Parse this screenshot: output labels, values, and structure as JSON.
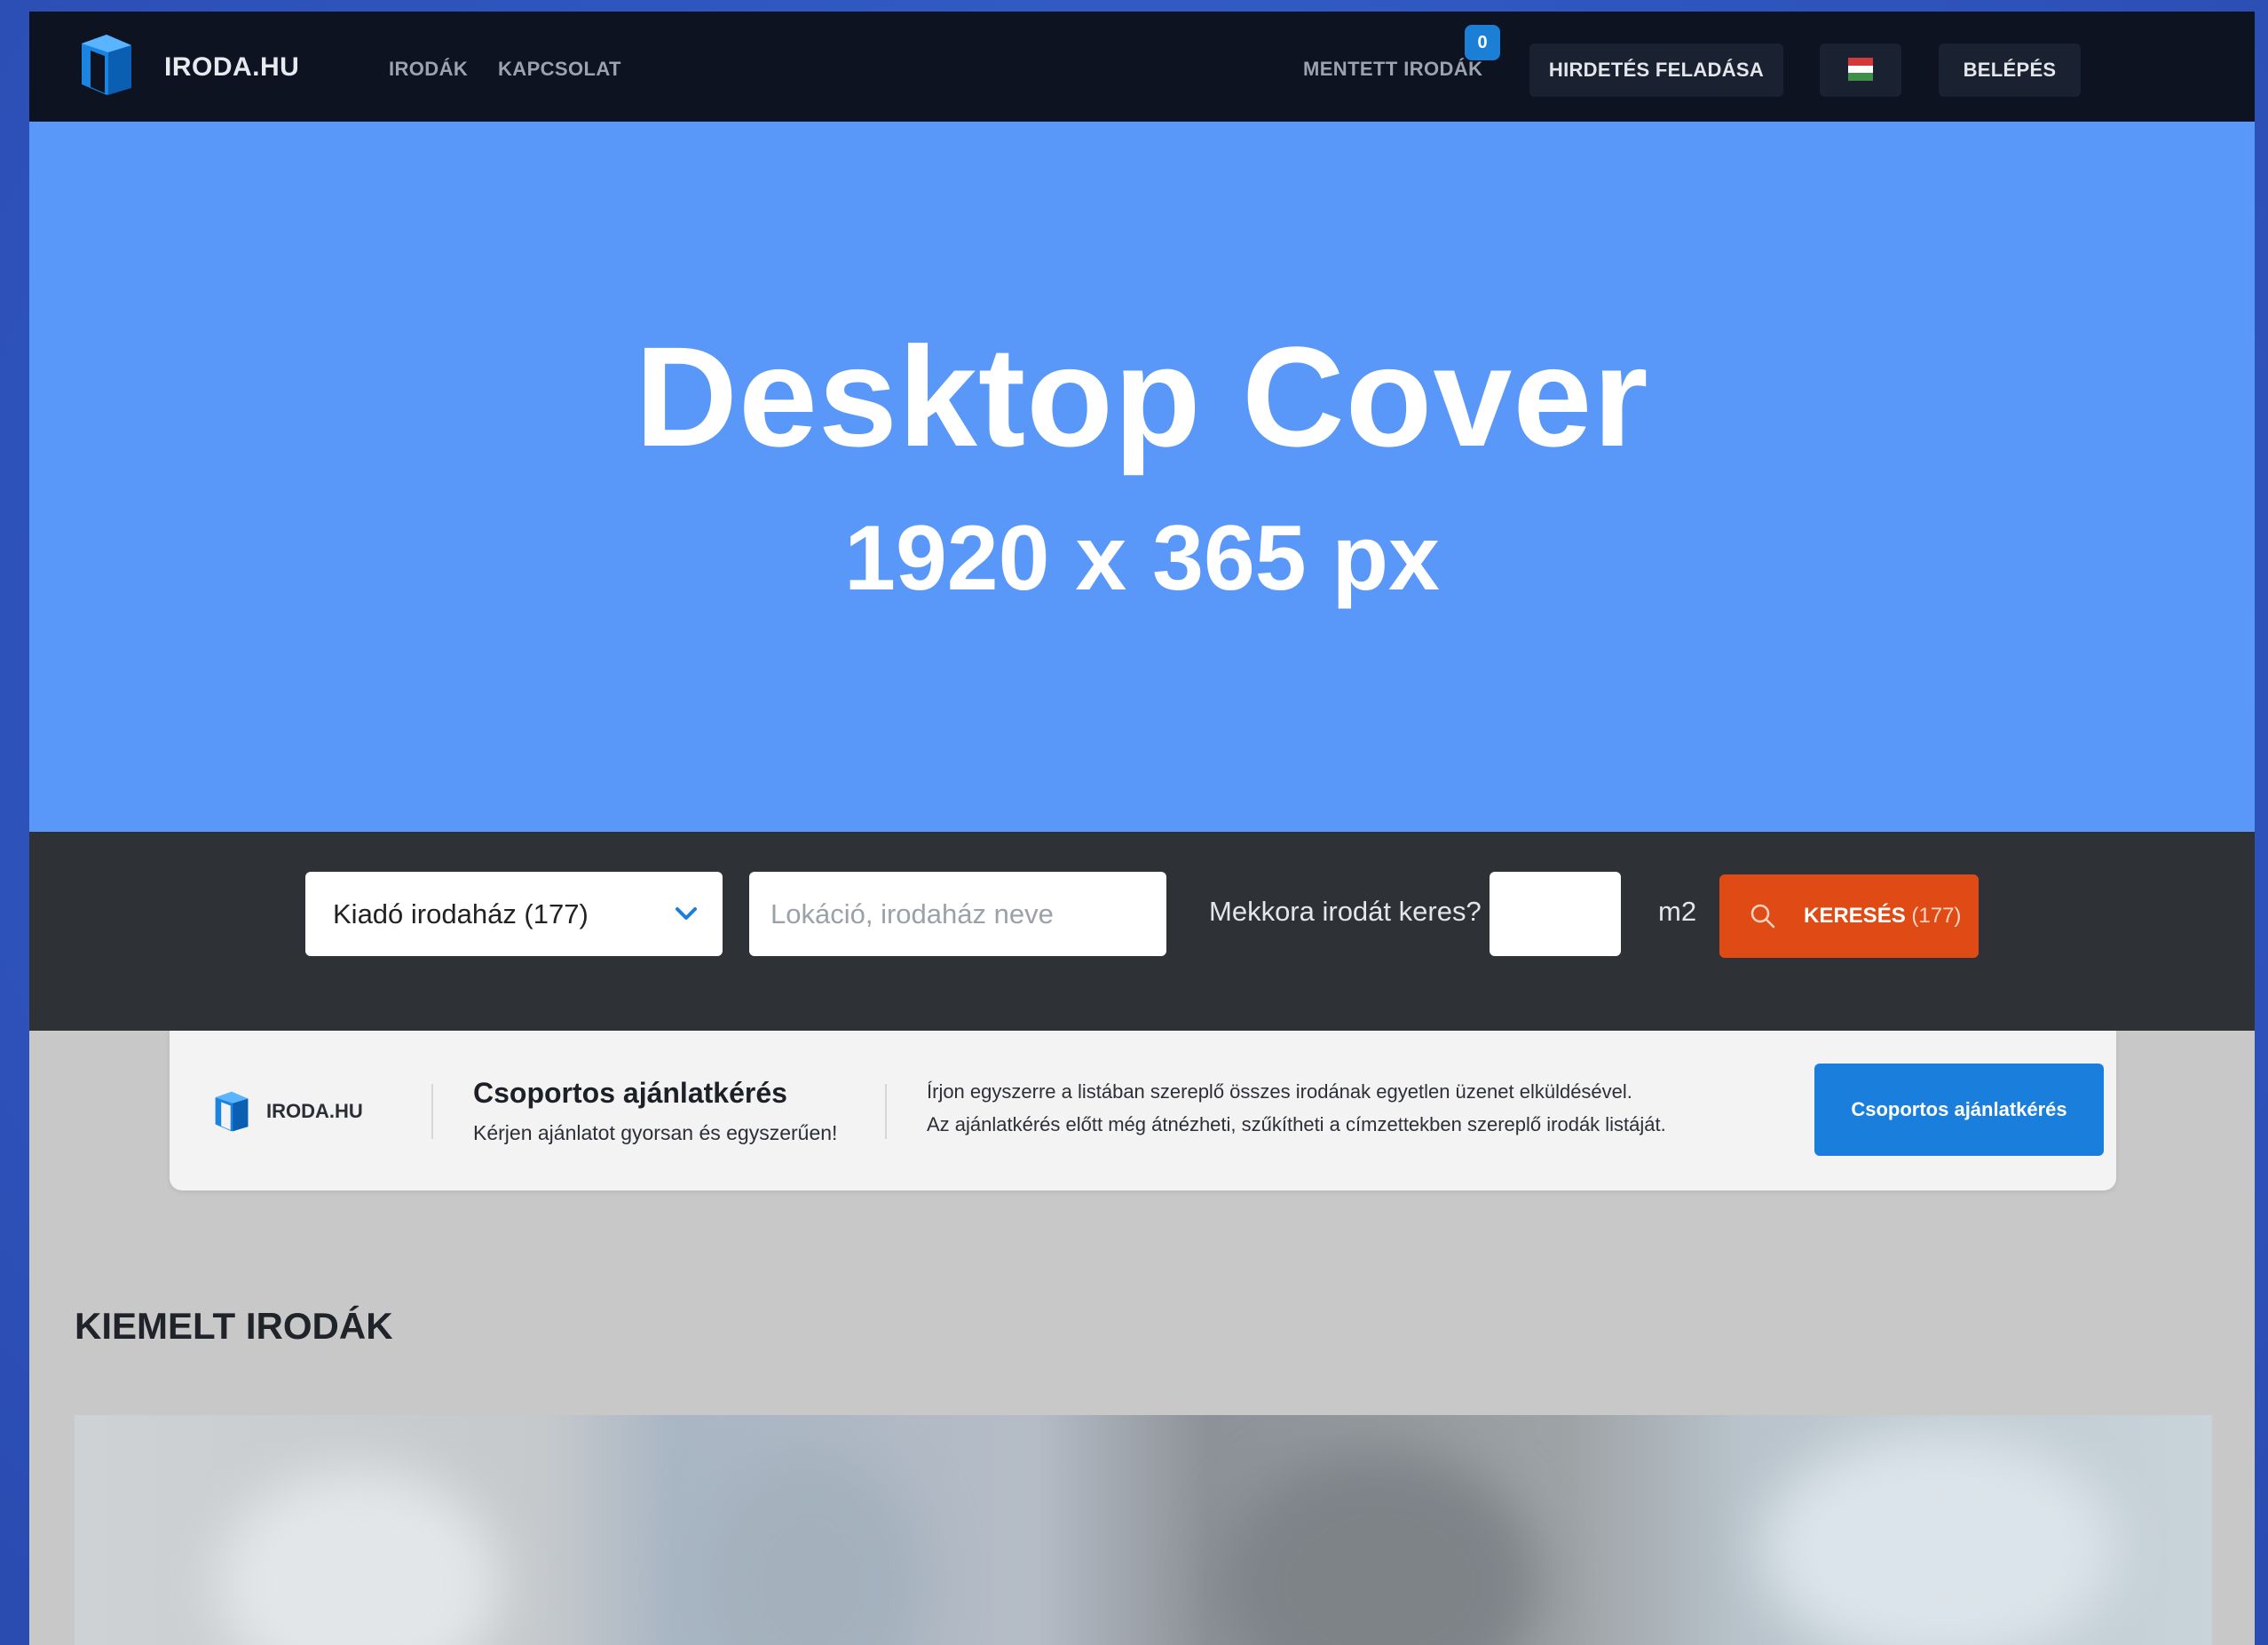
{
  "header": {
    "brand": "IRODA.HU",
    "nav": [
      "IRODÁK",
      "KAPCSOLAT"
    ],
    "saved_label": "MENTETT IRODÁK",
    "saved_count": "0",
    "post_ad_label": "HIRDETÉS FELADÁSA",
    "language_flag": "hungarian-flag",
    "login_label": "BELÉPÉS"
  },
  "cover": {
    "title": "Desktop Cover",
    "subtitle": "1920 x 365 px",
    "background": "#5998f8"
  },
  "search": {
    "type_selected": "Kiadó irodaház (177)",
    "location_placeholder": "Lokáció, irodaház neve",
    "size_question": "Mekkora irodát keres?",
    "size_value": "",
    "size_unit": "m2",
    "button_label": "KERESÉS",
    "button_count": "(177)",
    "button_color": "#e04a14"
  },
  "group_offer": {
    "brand": "IRODA.HU",
    "title": "Csoportos ajánlatkérés",
    "subtitle": "Kérjen ajánlatot gyorsan és egyszerűen!",
    "desc_line1": "Írjon egyszerre a listában szereplő összes irodának egyetlen üzenet elküldésével.",
    "desc_line2": "Az ajánlatkérés előtt még átnézheti, szűkítheti a címzettekben szereplő irodák listáját.",
    "button_label": "Csoportos ajánlatkérés",
    "button_color": "#1a7fdc"
  },
  "featured": {
    "title": "KIEMELT IRODÁK"
  }
}
